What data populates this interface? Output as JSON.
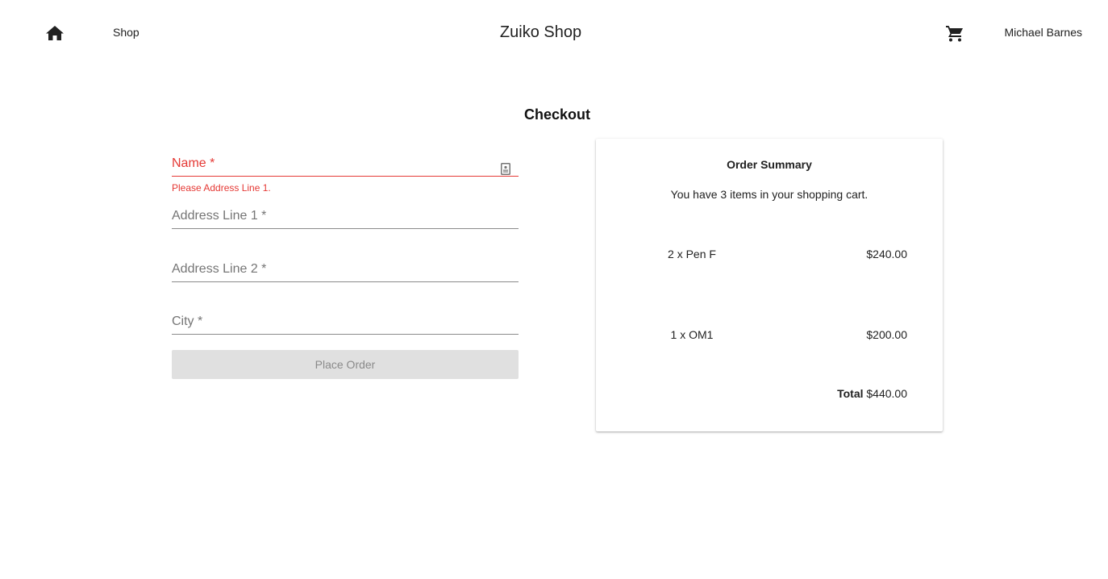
{
  "header": {
    "shop_link": "Shop",
    "title": "Zuiko Shop",
    "user_name": "Michael Barnes",
    "home_icon": "home-icon",
    "cart_icon": "shopping-cart-icon"
  },
  "page": {
    "title": "Checkout"
  },
  "form": {
    "name_label": "Name *",
    "name_error": "Please Address Line 1.",
    "address1_label": "Address Line 1 *",
    "address2_label": "Address Line 2 *",
    "city_label": "City *",
    "place_order_label": "Place Order",
    "error_color": "#e53935"
  },
  "summary": {
    "title": "Order Summary",
    "description": "You have 3 items in your shopping cart.",
    "items": [
      {
        "label": "2 x Pen F",
        "price": "$240.00"
      },
      {
        "label": "1 x OM1",
        "price": "$200.00"
      }
    ],
    "total_label": "Total",
    "total_value": "$440.00"
  }
}
